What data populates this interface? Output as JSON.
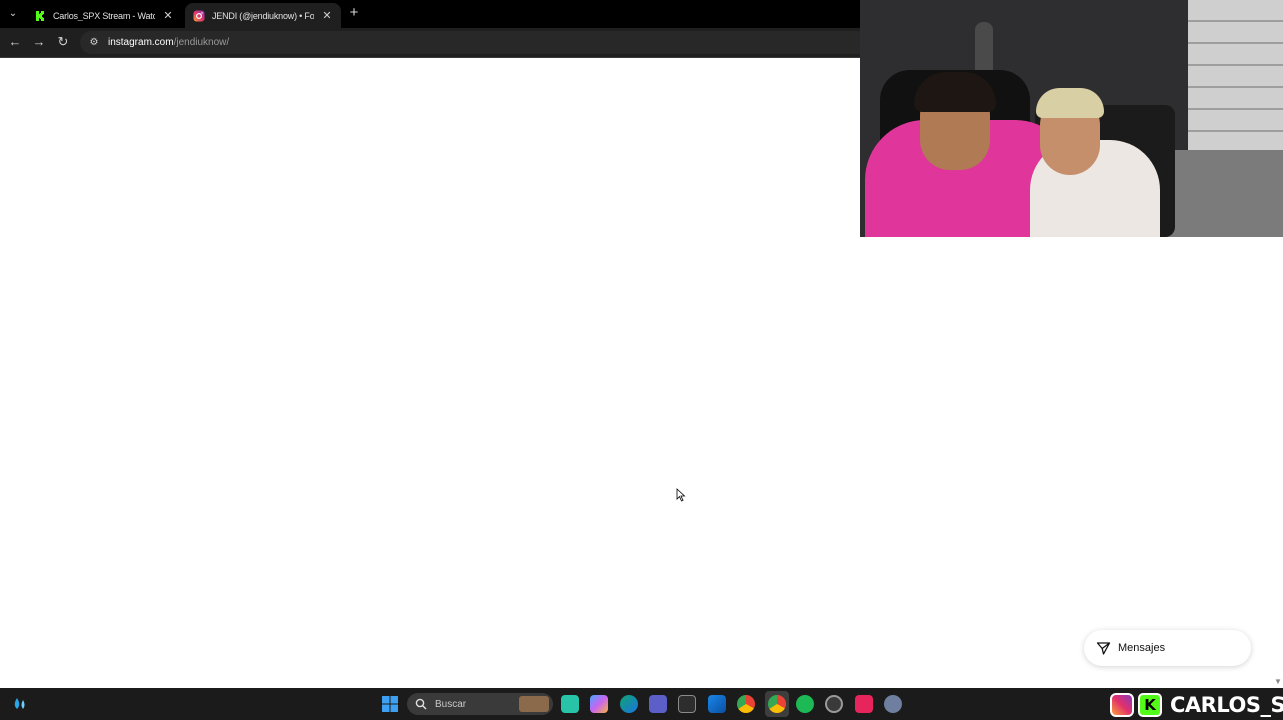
{
  "browser": {
    "tabs": [
      {
        "title": "Carlos_SPX Stream - Watch Live",
        "icon": "kick-icon",
        "active": false
      },
      {
        "title": "JENDI (@jendiuknow) • Fotos y",
        "icon": "instagram-icon",
        "active": true
      }
    ],
    "address": {
      "host": "instagram.com",
      "path": "/jendiuknow/"
    }
  },
  "page": {
    "messages_label": "Mensajes"
  },
  "taskbar": {
    "search_placeholder": "Buscar",
    "apps": [
      "windows-start-icon",
      "search-icon",
      "app-icon",
      "copilot-icon",
      "edge-icon",
      "teams-icon",
      "news-icon",
      "mail-icon",
      "chrome-icon",
      "chrome-active-icon",
      "spotify-icon",
      "app2-icon",
      "tiktok-icon",
      "settings-icon"
    ]
  },
  "overlay": {
    "streamer_name": "CARLOS_SPX"
  },
  "colors": {
    "kick_green": "#53fc18",
    "taskbar_bg": "#1b1b1b",
    "tab_active_bg": "#1f1f1f"
  }
}
